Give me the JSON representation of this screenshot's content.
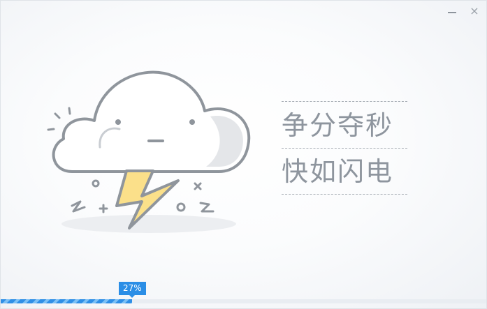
{
  "window": {
    "minimize_glyph": "–",
    "close_glyph": "×"
  },
  "illustration": {
    "icon": "cloud-lightning-icon",
    "colors": {
      "outline": "#8f959c",
      "cloud_fill": "#ffffff",
      "cloud_shade": "#e6e8eb",
      "bolt_fill": "#fbe08a",
      "bolt_stroke": "#8f959c",
      "ground": "#eceef1"
    }
  },
  "slogan": {
    "line1": "争分夺秒",
    "line2": "快如闪电"
  },
  "progress": {
    "label": "27%",
    "value": 0.27,
    "colors": {
      "accent": "#2b8ee6",
      "stripe": "#7cc0f5",
      "track": "#e9edf2"
    }
  }
}
